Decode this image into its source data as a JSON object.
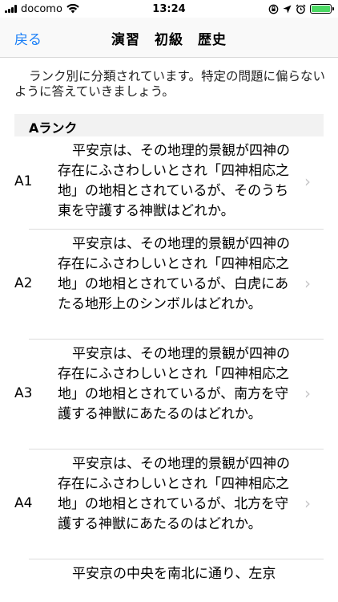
{
  "status": {
    "carrier": "docomo",
    "time": "13:24",
    "battery_color": "#4cd964"
  },
  "nav": {
    "back_label": "戻る",
    "title": "演習　初級　歴史",
    "accent": "#1a7ff7"
  },
  "intro": "ランク別に分類されています。特定の問題に偏らないように答えていきましょう。",
  "section": {
    "title": "Aランク"
  },
  "questions": [
    {
      "id": "A1",
      "text": "平安京は、その地理的景観が四神の存在にふさわしいとされ「四神相応之地」の地相とされているが、そのうち東を守護する神獣はどれか。"
    },
    {
      "id": "A2",
      "text": "平安京は、その地理的景観が四神の存在にふさわしいとされ「四神相応之地」の地相とされているが、白虎にあたる地形上のシンボルはどれか。"
    },
    {
      "id": "A3",
      "text": "平安京は、その地理的景観が四神の存在にふさわしいとされ「四神相応之地」の地相とされているが、南方を守護する神獣にあたるのはどれか。"
    },
    {
      "id": "A4",
      "text": "平安京は、その地理的景観が四神の存在にふさわしいとされ「四神相応之地」の地相とされているが、北方を守護する神獣にあたるのはどれか。"
    },
    {
      "id": "",
      "text": "平安京の中央を南北に通り、左京"
    }
  ]
}
